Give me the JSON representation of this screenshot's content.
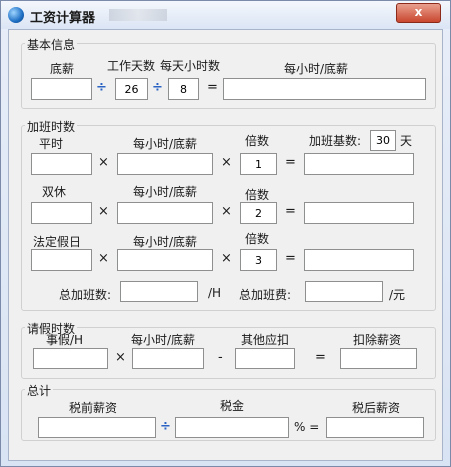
{
  "window": {
    "title": "工资计算器",
    "close_label": "x"
  },
  "basic": {
    "legend": "基本信息",
    "label_base": "底薪",
    "label_days": "工作天数",
    "label_hours": "每天小时数",
    "label_hourly": "每小时/底薪",
    "days_value": "26",
    "hours_value": "8",
    "op_div1": "÷",
    "op_div2": "÷",
    "op_eq": "="
  },
  "overtime": {
    "legend": "加班时数",
    "rows": [
      {
        "label": "平时",
        "hourly_label": "每小时/底薪",
        "mult_label": "倍数",
        "mult_value": "1"
      },
      {
        "label": "双休",
        "hourly_label": "每小时/底薪",
        "mult_label": "倍数",
        "mult_value": "2"
      },
      {
        "label": "法定假日",
        "hourly_label": "每小时/底薪",
        "mult_label": "倍数",
        "mult_value": "3"
      }
    ],
    "base_label": "加班基数:",
    "base_value": "30",
    "base_unit": "天",
    "op_x": "×",
    "op_eq": "=",
    "total_hours_label": "总加班数:",
    "total_hours_unit": "/H",
    "total_pay_label": "总加班费:",
    "total_pay_unit": "/元"
  },
  "leave": {
    "legend": "请假时数",
    "label_hours": "事假/H",
    "label_hourly": "每小时/底薪",
    "label_other": "其他应扣",
    "label_deduct": "扣除薪资",
    "op_x": "×",
    "op_minus": "-",
    "op_eq": "="
  },
  "total": {
    "legend": "总计",
    "label_pre": "税前薪资",
    "label_tax": "税金",
    "label_after": "税后薪资",
    "op_div": "÷",
    "op_pct": "% ="
  }
}
